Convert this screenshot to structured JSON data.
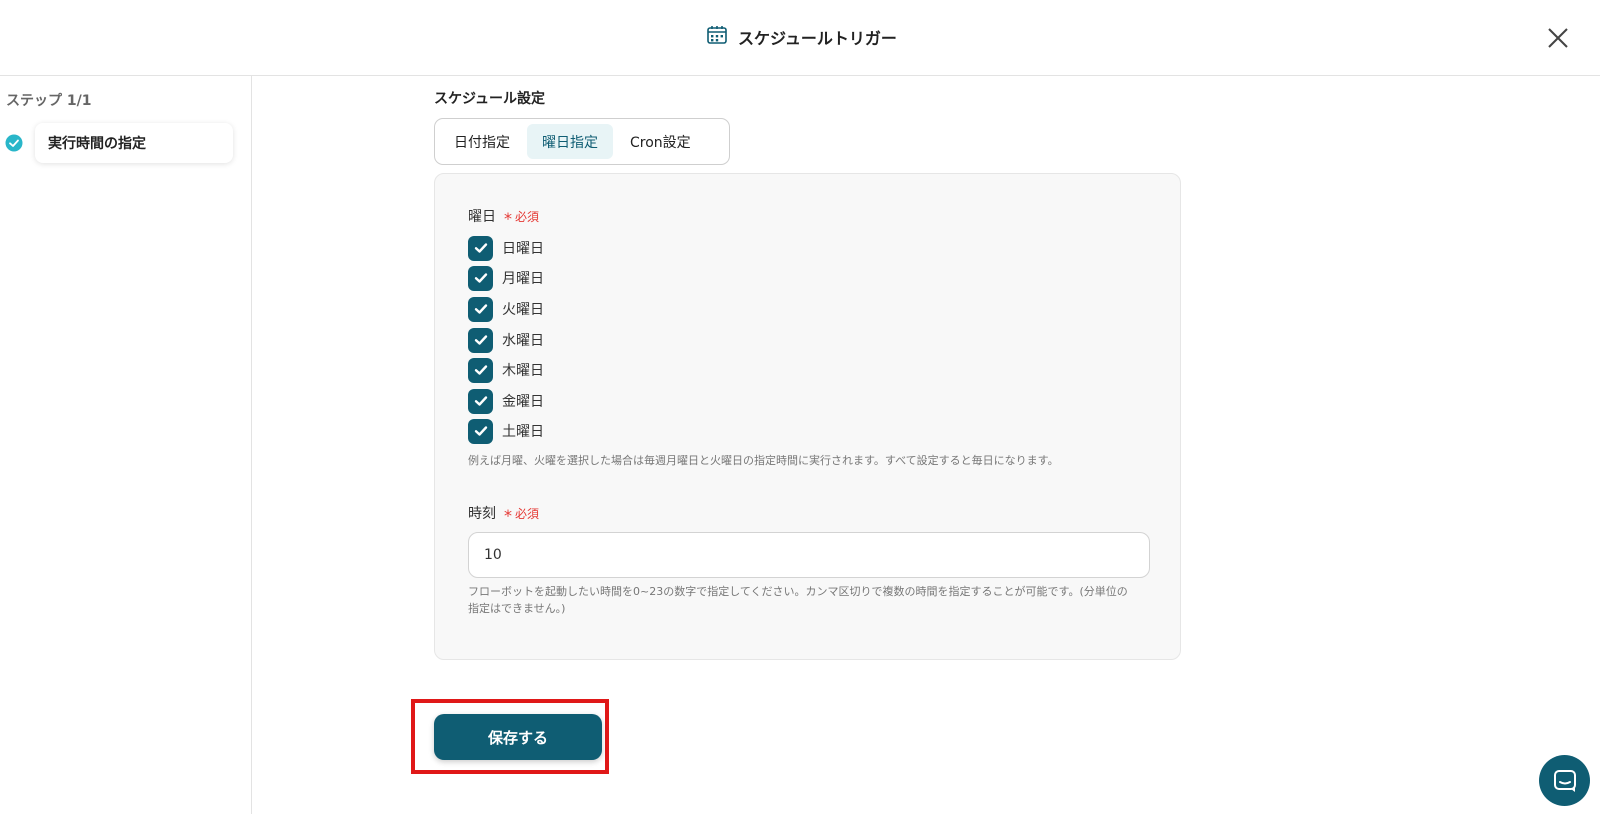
{
  "header": {
    "title": "スケジュールトリガー",
    "icon": "calendar-schedule-icon",
    "close_icon": "close-icon"
  },
  "sidebar": {
    "step_heading": "ステップ 1/1",
    "steps": [
      {
        "label": "実行時間の指定",
        "status": "completed"
      }
    ]
  },
  "main": {
    "section_label": "スケジュール設定",
    "tabs": [
      {
        "label": "日付指定",
        "active": false
      },
      {
        "label": "曜日指定",
        "active": true
      },
      {
        "label": "Cron設定",
        "active": false
      }
    ],
    "weekday_field": {
      "label": "曜日",
      "required_mark": "*",
      "required_text": "必須",
      "options": [
        {
          "label": "日曜日",
          "checked": true
        },
        {
          "label": "月曜日",
          "checked": true
        },
        {
          "label": "火曜日",
          "checked": true
        },
        {
          "label": "水曜日",
          "checked": true
        },
        {
          "label": "木曜日",
          "checked": true
        },
        {
          "label": "金曜日",
          "checked": true
        },
        {
          "label": "土曜日",
          "checked": true
        }
      ],
      "help": "例えば月曜、火曜を選択した場合は毎週月曜日と火曜日の指定時間に実行されます。すべて設定すると毎日になります。"
    },
    "time_field": {
      "label": "時刻",
      "required_mark": "*",
      "required_text": "必須",
      "value": "10",
      "help_line1": "フローボットを起動したい時間を0~23の数字で指定してください。カンマ区切りで複数の時間を指定することが可能です。(分単位の",
      "help_line2": "指定はできません。)"
    },
    "save_label": "保存する"
  },
  "colors": {
    "primary": "#0f5d73",
    "accent_check": "#29b6c9",
    "required": "#e53935",
    "highlight_box": "#e01818"
  }
}
